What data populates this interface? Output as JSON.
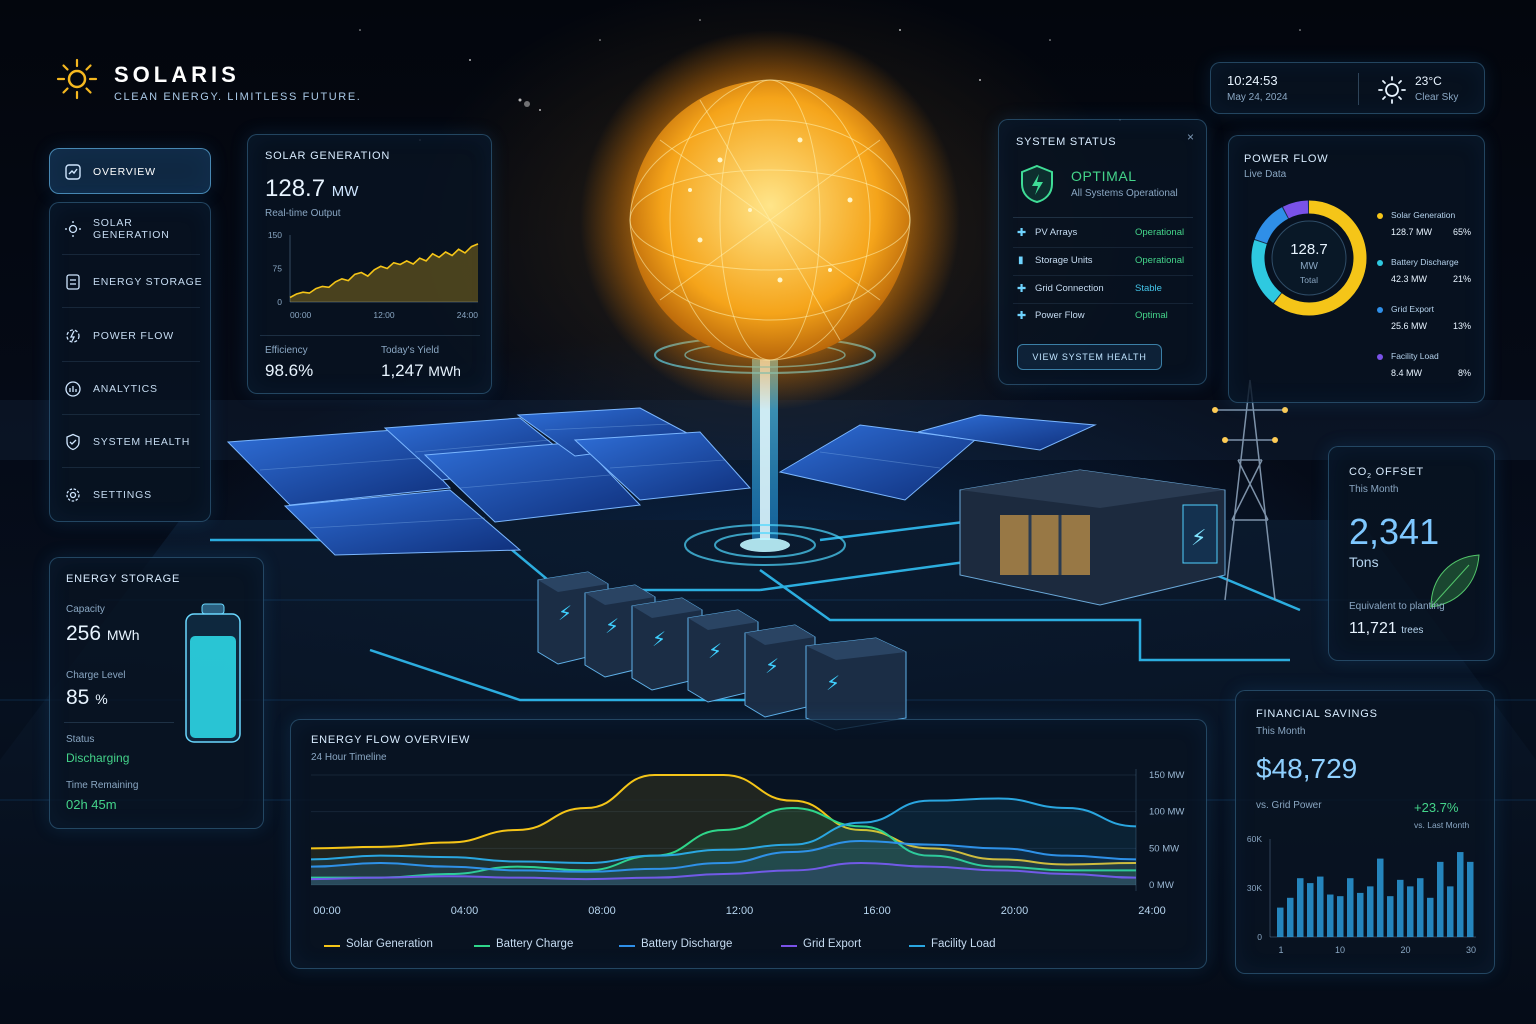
{
  "brand": {
    "name": "SOLARIS",
    "tagline": "CLEAN ENERGY. LIMITLESS FUTURE."
  },
  "header": {
    "time": "10:24:53",
    "date": "May 24, 2024",
    "temperature": "23°C",
    "condition": "Clear Sky",
    "weather_icon": "sun-icon"
  },
  "sidebar": {
    "items": [
      {
        "label": "OVERVIEW",
        "icon": "overview-icon",
        "active": true
      },
      {
        "label": "SOLAR GENERATION",
        "icon": "solar-panel-icon"
      },
      {
        "label": "ENERGY STORAGE",
        "icon": "battery-icon"
      },
      {
        "label": "POWER FLOW",
        "icon": "power-flow-icon"
      },
      {
        "label": "ANALYTICS",
        "icon": "analytics-icon"
      },
      {
        "label": "SYSTEM HEALTH",
        "icon": "shield-icon"
      },
      {
        "label": "SETTINGS",
        "icon": "gear-icon"
      }
    ]
  },
  "solar_generation": {
    "title": "SOLAR GENERATION",
    "value": "128.7",
    "unit": "MW",
    "caption": "Real-time Output",
    "efficiency_label": "Efficiency",
    "efficiency_value": "98.6%",
    "yield_label": "Today's Yield",
    "yield_value": "1,247",
    "yield_unit": "MWh",
    "chart": {
      "y_ticks": [
        "150",
        "75",
        "0"
      ],
      "x_ticks": [
        "00:00",
        "12:00",
        "24:00"
      ],
      "values": [
        10,
        18,
        22,
        20,
        30,
        35,
        33,
        45,
        52,
        48,
        62,
        66,
        58,
        72,
        80,
        75,
        88,
        84,
        92,
        85,
        98,
        92,
        108,
        100,
        112,
        104,
        118,
        110,
        124,
        130
      ]
    }
  },
  "system_status": {
    "title": "SYSTEM STATUS",
    "state": "OPTIMAL",
    "state_caption": "All Systems Operational",
    "rows": [
      {
        "label": "PV Arrays",
        "status": "Operational",
        "color": "#44d48a"
      },
      {
        "label": "Storage Units",
        "status": "Operational",
        "color": "#44d48a"
      },
      {
        "label": "Grid Connection",
        "status": "Stable",
        "color": "#44c4e8"
      },
      {
        "label": "Power Flow",
        "status": "Optimal",
        "color": "#44d48a"
      }
    ],
    "button": "VIEW SYSTEM HEALTH",
    "close": "×"
  },
  "power_flow": {
    "title": "POWER FLOW",
    "subtitle": "Live Data",
    "center_value": "128.7",
    "center_unit": "MW",
    "center_caption": "Total",
    "items": [
      {
        "label": "Solar Generation",
        "value": "128.7 MW",
        "pct": "65%",
        "fraction": 0.65,
        "color": "#f5c518"
      },
      {
        "label": "Battery Discharge",
        "value": "42.3 MW",
        "pct": "21%",
        "fraction": 0.21,
        "color": "#2ec9e0"
      },
      {
        "label": "Grid Export",
        "value": "25.6 MW",
        "pct": "13%",
        "fraction": 0.13,
        "color": "#2f8fe8"
      },
      {
        "label": "Facility Load",
        "value": "8.4 MW",
        "pct": "8%",
        "fraction": 0.08,
        "color": "#7a52e8"
      }
    ]
  },
  "energy_storage": {
    "title": "ENERGY STORAGE",
    "capacity_label": "Capacity",
    "capacity_value": "256",
    "capacity_unit": "MWh",
    "charge_label": "Charge Level",
    "charge_value": "85",
    "charge_unit": "%",
    "charge_fraction": 0.85,
    "status_label": "Status",
    "status_value": "Discharging",
    "remaining_label": "Time Remaining",
    "remaining_value": "02h 45m"
  },
  "co2_offset": {
    "title_prefix": "CO",
    "title_sub": "2",
    "title_suffix": " OFFSET",
    "subtitle": "This Month",
    "value": "2,341",
    "unit": "Tons",
    "equiv_label": "Equivalent to planting",
    "equiv_value": "11,721",
    "equiv_unit": "trees"
  },
  "energy_flow": {
    "title": "ENERGY FLOW OVERVIEW",
    "subtitle": "24 Hour Timeline",
    "x_ticks": [
      "00:00",
      "04:00",
      "08:00",
      "12:00",
      "16:00",
      "20:00",
      "24:00"
    ],
    "y_ticks": [
      "150 MW",
      "100 MW",
      "50 MW",
      "0 MW"
    ],
    "ylim": [
      0,
      150
    ]
  },
  "chart_data": {
    "type": "area",
    "title": "ENERGY FLOW OVERVIEW",
    "subtitle": "24 Hour Timeline",
    "x": [
      "00:00",
      "02:00",
      "04:00",
      "06:00",
      "08:00",
      "10:00",
      "12:00",
      "14:00",
      "16:00",
      "18:00",
      "20:00",
      "22:00",
      "24:00"
    ],
    "ylim": [
      0,
      150
    ],
    "series": [
      {
        "name": "Solar Generation",
        "color": "#f5c518",
        "values": [
          50,
          52,
          58,
          75,
          105,
          150,
          150,
          115,
          75,
          50,
          35,
          28,
          30
        ]
      },
      {
        "name": "Battery Charge",
        "color": "#2fd68a",
        "values": [
          10,
          10,
          15,
          25,
          20,
          40,
          75,
          105,
          80,
          40,
          25,
          20,
          20
        ]
      },
      {
        "name": "Battery Discharge",
        "color": "#2f8fe8",
        "values": [
          25,
          30,
          25,
          20,
          18,
          22,
          30,
          45,
          60,
          55,
          50,
          40,
          35
        ]
      },
      {
        "name": "Grid Export",
        "color": "#7a52e8",
        "values": [
          8,
          10,
          12,
          10,
          8,
          10,
          15,
          20,
          30,
          25,
          20,
          15,
          10
        ]
      },
      {
        "name": "Facility Load",
        "color": "#2aa6e0",
        "values": [
          35,
          40,
          38,
          32,
          30,
          40,
          48,
          55,
          85,
          115,
          118,
          105,
          80
        ]
      }
    ]
  },
  "financial_savings": {
    "title": "FINANCIAL SAVINGS",
    "subtitle": "This Month",
    "value": "$48,729",
    "compare_label": "vs. Grid Power",
    "change": "+23.7%",
    "change_caption": "vs. Last Month",
    "y_ticks": [
      "60K",
      "30K",
      "0"
    ],
    "x_ticks": [
      "1",
      "10",
      "20",
      "30"
    ],
    "ylim": [
      0,
      60000
    ],
    "bars": [
      18000,
      24000,
      36000,
      33000,
      37000,
      26000,
      25000,
      36000,
      27000,
      31000,
      48000,
      25000,
      35000,
      31000,
      36000,
      24000,
      46000,
      31000,
      52000,
      46000
    ]
  }
}
